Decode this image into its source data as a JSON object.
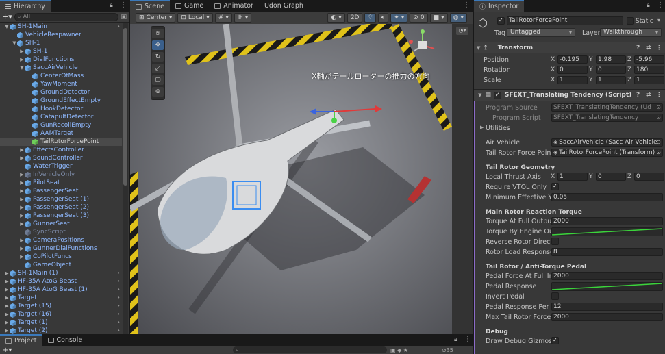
{
  "hierarchy": {
    "tab": "Hierarchy",
    "search_placeholder": "All",
    "rows": [
      {
        "label": "SH-1Main",
        "depth": 1,
        "expanded": true,
        "chevron": true
      },
      {
        "label": "VehicleRespawner",
        "depth": 2
      },
      {
        "label": "SH-1",
        "depth": 2,
        "expanded": true
      },
      {
        "label": "SH-1",
        "depth": 3,
        "collapsed": true
      },
      {
        "label": "DialFunctions",
        "depth": 3,
        "collapsed": true
      },
      {
        "label": "SaccAirVehicle",
        "depth": 3,
        "expanded": true
      },
      {
        "label": "CenterOfMass",
        "depth": 4
      },
      {
        "label": "YawMoment",
        "depth": 4
      },
      {
        "label": "GroundDetector",
        "depth": 4
      },
      {
        "label": "GroundEffectEmpty",
        "depth": 4
      },
      {
        "label": "HookDetector",
        "depth": 4
      },
      {
        "label": "CatapultDetector",
        "depth": 4
      },
      {
        "label": "GunRecoilEmpty",
        "depth": 4
      },
      {
        "label": "AAMTarget",
        "depth": 4
      },
      {
        "label": "TailRotorForcePoint",
        "depth": 4,
        "selected": true
      },
      {
        "label": "EffectsController",
        "depth": 3,
        "collapsed": true
      },
      {
        "label": "SoundController",
        "depth": 3,
        "collapsed": true
      },
      {
        "label": "WaterTrigger",
        "depth": 3
      },
      {
        "label": "InVehicleOnly",
        "depth": 3,
        "collapsed": true,
        "dim": true
      },
      {
        "label": "PilotSeat",
        "depth": 3,
        "collapsed": true
      },
      {
        "label": "PassengerSeat",
        "depth": 3,
        "collapsed": true
      },
      {
        "label": "PassengerSeat (1)",
        "depth": 3,
        "collapsed": true
      },
      {
        "label": "PassengerSeat (2)",
        "depth": 3,
        "collapsed": true
      },
      {
        "label": "PassengerSeat (3)",
        "depth": 3,
        "collapsed": true
      },
      {
        "label": "GunnerSeat",
        "depth": 3,
        "collapsed": true
      },
      {
        "label": "SyncScript",
        "depth": 3,
        "dim": true
      },
      {
        "label": "CameraPositions",
        "depth": 3,
        "collapsed": true
      },
      {
        "label": "GunnerDialFunctions",
        "depth": 3,
        "collapsed": true
      },
      {
        "label": "CoPilotFuncs",
        "depth": 3,
        "collapsed": true
      },
      {
        "label": "GameObject",
        "depth": 3
      },
      {
        "label": "SH-1Main (1)",
        "depth": 1,
        "collapsed": true,
        "chevron": true
      },
      {
        "label": "HF-35A AtoG Beast",
        "depth": 1,
        "collapsed": true,
        "chevron": true
      },
      {
        "label": "HF-35A AtoG Beast (1)",
        "depth": 1,
        "collapsed": true,
        "chevron": true
      },
      {
        "label": "Target",
        "depth": 1,
        "collapsed": true,
        "chevron": true
      },
      {
        "label": "Target (15)",
        "depth": 1,
        "collapsed": true,
        "chevron": true
      },
      {
        "label": "Target (16)",
        "depth": 1,
        "collapsed": true,
        "chevron": true
      },
      {
        "label": "Target (1)",
        "depth": 1,
        "collapsed": true,
        "chevron": true
      },
      {
        "label": "Target (2)",
        "depth": 1,
        "collapsed": true,
        "chevron": true
      }
    ]
  },
  "scene_tabs": [
    {
      "label": "Scene",
      "active": true
    },
    {
      "label": "Game"
    },
    {
      "label": "Animator"
    },
    {
      "label": "Udon Graph"
    }
  ],
  "scene_toolbar": {
    "pivot": "Center",
    "space": "Local",
    "mode_2d": "2D"
  },
  "scene_annotation": "X軸がテールローターの推力の方向",
  "bottom": {
    "tabs": [
      "Project",
      "Console"
    ],
    "count": "35"
  },
  "inspector": {
    "tab": "Inspector",
    "object_name": "TailRotorForcePoint",
    "static_label": "Static",
    "tag_label": "Tag",
    "tag_value": "Untagged",
    "layer_label": "Layer",
    "layer_value": "Walkthrough",
    "transform": {
      "title": "Transform",
      "position_label": "Position",
      "position": [
        "-0.195",
        "1.98",
        "-5.96"
      ],
      "rotation_label": "Rotation",
      "rotation": [
        "0",
        "0",
        "180"
      ],
      "scale_label": "Scale",
      "scale": [
        "1",
        "1",
        "1"
      ]
    },
    "script": {
      "title": "SFEXT_Translating Tendency (Script)",
      "program_source_label": "Program Source",
      "program_source": "SFEXT_TranslatingTendency (Ud",
      "program_script_label": "Program Script",
      "program_script": "SFEXT_TranslatingTendency",
      "utilities": "Utilities",
      "air_vehicle_label": "Air Vehicle",
      "air_vehicle": "SaccAirVehicle (Sacc Air Vehicle",
      "tail_point_label": "Tail Rotor Force Point",
      "tail_point": "TailRotorForcePoint (Transform)",
      "geom_header": "Tail Rotor Geometry",
      "local_thrust_label": "Local Thrust Axis",
      "local_thrust": [
        "1",
        "0",
        "0"
      ],
      "require_vtol_label": "Require VTOL Only",
      "min_yaw_label": "Minimum Effective Yaw",
      "min_yaw": "0.05",
      "main_header": "Main Rotor Reaction Torque",
      "torque_full_label": "Torque At Full Output N",
      "torque_full": "2000",
      "torque_curve_label": "Torque By Engine Outp",
      "reverse_label": "Reverse Rotor Directio",
      "load_resp_label": "Rotor Load Response F",
      "load_resp": "8",
      "pedal_header": "Tail Rotor / Anti-Torque Pedal",
      "pedal_force_label": "Pedal Force At Full Inp",
      "pedal_force": "2000",
      "pedal_resp_label": "Pedal Response",
      "invert_label": "Invert Pedal",
      "pedal_per_sec_label": "Pedal Response Per Se",
      "pedal_per_sec": "12",
      "max_tail_label": "Max Tail Rotor Force N",
      "max_tail": "2000",
      "debug_header": "Debug",
      "draw_debug_label": "Draw Debug Gizmos"
    }
  },
  "colors": {
    "accent": "#3a79bb",
    "selection": "#4a4a4a",
    "link": "#8fb9ff",
    "curve": "#3bd43b"
  }
}
